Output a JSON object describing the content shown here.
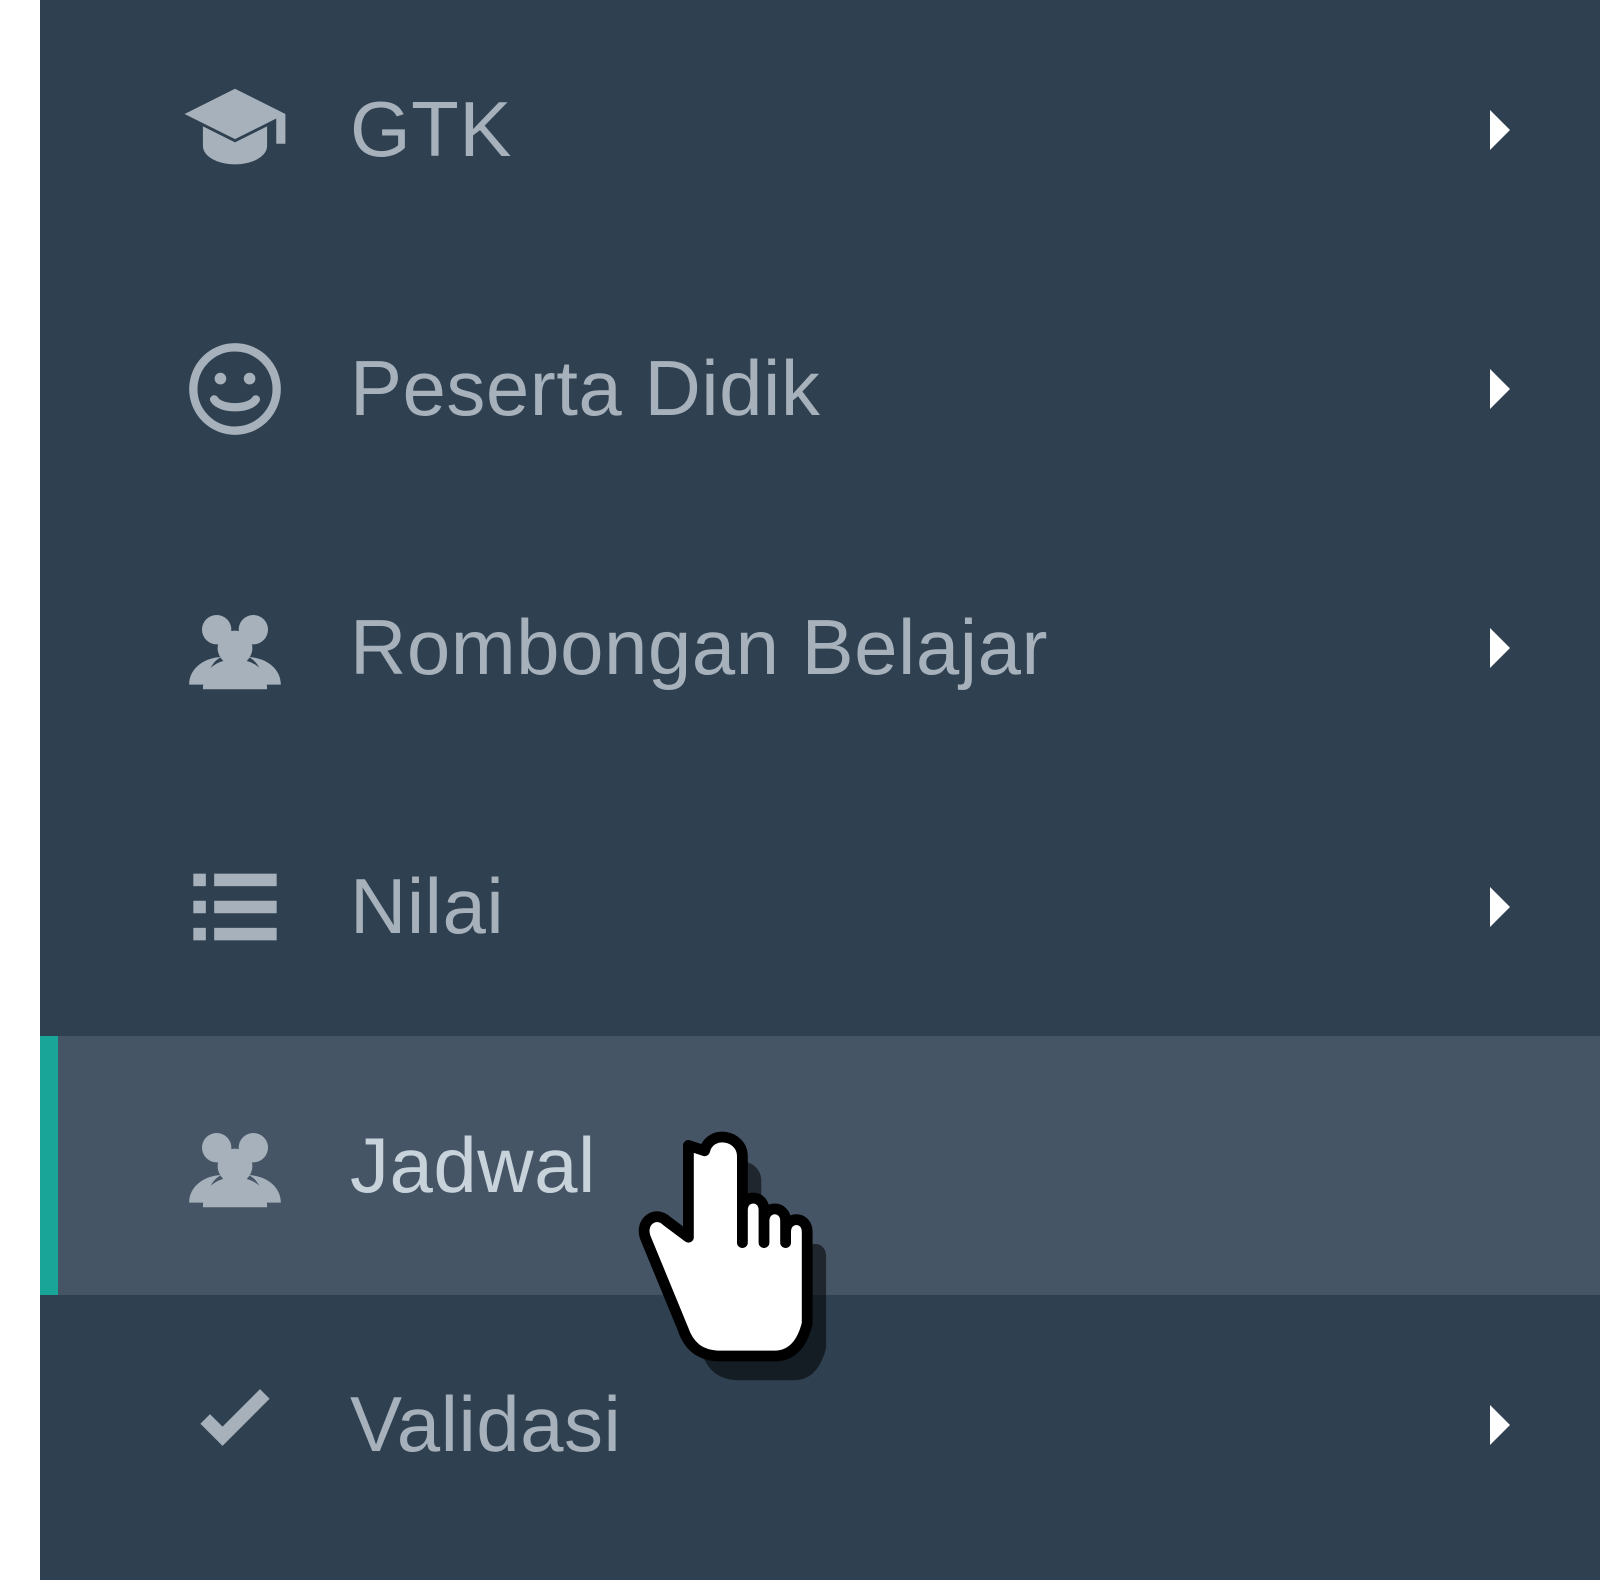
{
  "sidebar": {
    "items": [
      {
        "label": "GTK",
        "icon": "graduation-cap-icon",
        "has_children": true,
        "active": false
      },
      {
        "label": "Peserta Didik",
        "icon": "smile-icon",
        "has_children": true,
        "active": false
      },
      {
        "label": "Rombongan Belajar",
        "icon": "users-icon",
        "has_children": true,
        "active": false
      },
      {
        "label": "Nilai",
        "icon": "list-icon",
        "has_children": true,
        "active": false
      },
      {
        "label": "Jadwal",
        "icon": "users-icon",
        "has_children": false,
        "active": true
      },
      {
        "label": "Validasi",
        "icon": "check-icon",
        "has_children": true,
        "active": false
      }
    ]
  },
  "cursor": {
    "type": "pointer-hand",
    "over_item_index": 4
  },
  "colors": {
    "sidebar_bg": "#2f4050",
    "text": "#a6b1bb",
    "active_bg": "#465565",
    "accent": "#19a598"
  }
}
